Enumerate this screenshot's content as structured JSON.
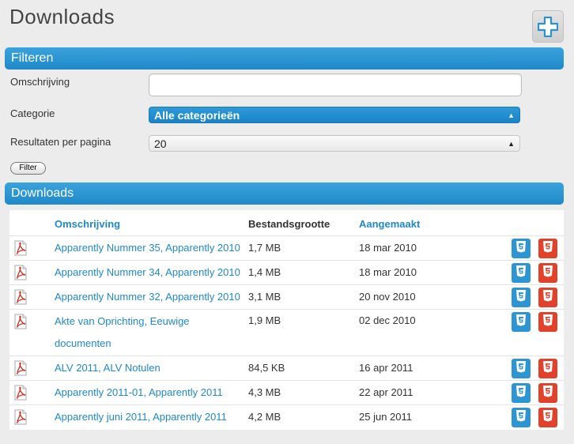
{
  "page": {
    "title": "Downloads"
  },
  "filter": {
    "section_title": "Filteren",
    "description_label": "Omschrijving",
    "description_value": "",
    "category_label": "Categorie",
    "category_value": "Alle categorieën",
    "results_label": "Resultaten per pagina",
    "results_value": "20",
    "button_label": "Filter"
  },
  "downloads": {
    "section_title": "Downloads",
    "columns": {
      "description": "Omschrijving",
      "size": "Bestandsgrootte",
      "created": "Aangemaakt"
    },
    "rows": [
      {
        "description": "Apparently Nummer 35, Apparently 2010",
        "size": "1,7 MB",
        "created": "18 mar 2010"
      },
      {
        "description": "Apparently Nummer 34, Apparently 2010",
        "size": "1,4 MB",
        "created": "18 mar 2010"
      },
      {
        "description": "Apparently Nummer 32, Apparently 2010",
        "size": "3,1 MB",
        "created": "20 nov 2010"
      },
      {
        "description": "Akte van Oprichting, Eeuwige documenten",
        "size": "1,9 MB",
        "created": "02 dec 2010"
      },
      {
        "description": "ALV 2011, ALV Notulen",
        "size": "84,5 KB",
        "created": "16 apr 2011"
      },
      {
        "description": "Apparently 2011-01, Apparently 2011",
        "size": "4,3 MB",
        "created": "22 apr 2011"
      },
      {
        "description": "Apparently juni 2011, Apparently 2011",
        "size": "4,2 MB",
        "created": "25 jun 2011"
      }
    ]
  },
  "colors": {
    "accent": "#1f89c9",
    "delete": "#e2412a",
    "background": "#ececec"
  },
  "icons": {
    "add": "plus-icon",
    "file": "pdf-icon",
    "edit": "css3-shield-icon",
    "delete": "html5-shield-icon"
  }
}
